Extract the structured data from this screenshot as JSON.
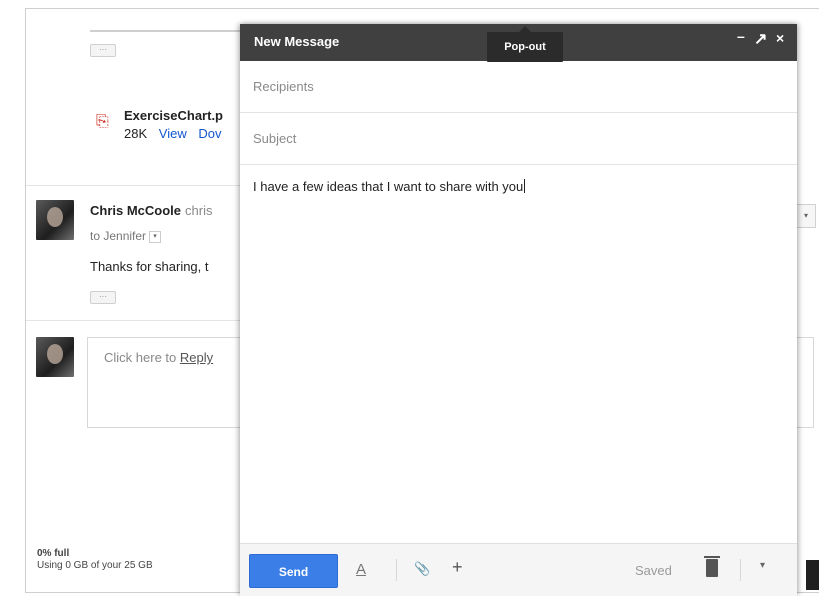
{
  "thread": {
    "attachment": {
      "name": "ExerciseChart.p",
      "size": "28K",
      "view_label": "View",
      "download_label": "Dov"
    },
    "message": {
      "sender_name": "Chris McCoole",
      "sender_email": "chris",
      "to_label": "to Jennifer",
      "to_dropdown": "▾",
      "body": "Thanks for sharing, t",
      "dots": "···"
    },
    "reply": {
      "prefix": "Click here to ",
      "link": "Reply"
    },
    "first_dots": "···",
    "side_arrow": "▾"
  },
  "storage": {
    "percent": "0% full",
    "usage": "Using 0 GB of your 25 GB"
  },
  "compose": {
    "title": "New Message",
    "controls": {
      "minimize": "–",
      "popout": "↗",
      "close": "×"
    },
    "tooltip": "Pop-out",
    "recipients_placeholder": "Recipients",
    "subject_placeholder": "Subject",
    "body": "I have a few ideas that I want to share with you",
    "toolbar": {
      "send_label": "Send",
      "formatting_icon": "A",
      "attach_icon": "📎",
      "insert_icon": "+",
      "saved_label": "Saved",
      "more_icon": "▾"
    }
  },
  "colors": {
    "title_bar": "#404040",
    "send_button": "#3b7ee7",
    "link": "#1155cc"
  }
}
